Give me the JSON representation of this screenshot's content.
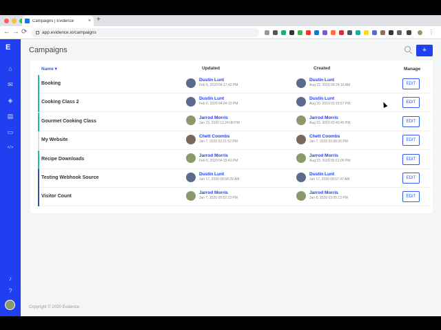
{
  "browser": {
    "tab_title": "Campaigns | Evidence",
    "url": "app.evidence.io/campaigns",
    "new_tab": "+",
    "close": "×",
    "back": "←",
    "forward": "→",
    "reload": "⟳"
  },
  "sidebar": {
    "logo": "E",
    "icons": [
      "home-icon",
      "megaphone-icon",
      "analytics-icon",
      "layers-icon",
      "inbox-icon",
      "code-icon",
      "bell-icon",
      "help-icon"
    ],
    "glyphs": [
      "⌂",
      "✉",
      "◈",
      "▤",
      "▭",
      "</>",
      "♪",
      "?"
    ]
  },
  "page": {
    "title": "Campaigns",
    "add_label": "+",
    "footer": "Copyright © 2020 Evidence"
  },
  "table": {
    "headers": {
      "name": "Name",
      "updated": "Updated",
      "created": "Created",
      "manage": "Manage"
    },
    "edit_label": "EDIT",
    "rows": [
      {
        "name": "Booking",
        "bar": "#1abc9c",
        "updated_by": "Dustin Lunt",
        "updated_at": "Feb 6, 2020 04:17:42 PM",
        "created_by": "Dustin Lunt",
        "created_at": "Aug 22, 2019 09:24:16 AM"
      },
      {
        "name": "Cooking Class 2",
        "bar": "#1abc9c",
        "updated_by": "Dustin Lunt",
        "updated_at": "Feb 6, 2020 04:04:10 PM",
        "created_by": "Dustin Lunt",
        "created_at": "Aug 20, 2019 03:15:57 PM"
      },
      {
        "name": "Gourmet Cooking Class",
        "bar": "#1abc9c",
        "updated_by": "Jarrod Morris",
        "updated_at": "Jan 15, 2020 12:24:08 PM",
        "created_by": "Jarrod Morris",
        "created_at": "Aug 15, 2019 03:43:45 PM"
      },
      {
        "name": "My Website",
        "bar": "#dddddd",
        "updated_by": "Chett Coombs",
        "updated_at": "Jan 7, 2020 02:21:52 PM",
        "created_by": "Chett Coombs",
        "created_at": "Jan 7, 2020 02:08:26 PM"
      },
      {
        "name": "Recipe Downloads",
        "bar": "#1abc9c",
        "updated_by": "Jarrod Morris",
        "updated_at": "Feb 6, 2020 04:33:41 PM",
        "created_by": "Jarrod Morris",
        "created_at": "Aug 15, 2019 05:51:06 PM"
      },
      {
        "name": "Testing Webhook Source",
        "bar": "#3949ab",
        "updated_by": "Dustin Lunt",
        "updated_at": "Jan 17, 2020 08:58:29 AM",
        "created_by": "Dustin Lunt",
        "created_at": "Jan 17, 2020 08:57:47 AM"
      },
      {
        "name": "Visitor Count",
        "bar": "#3949ab",
        "updated_by": "Jarrod Morris",
        "updated_at": "Jan 7, 2020 09:52:23 PM",
        "created_by": "Jarrod Morris",
        "created_at": "Jan 8, 2020 03:05:13 PM"
      }
    ]
  },
  "colors": {
    "brand": "#1f3ff0",
    "link": "#2f5bea",
    "avatars": {
      "Dustin Lunt": "#5a6b8c",
      "Jarrod Morris": "#8a9a6b",
      "Chett Coombs": "#7b6a5a"
    }
  }
}
